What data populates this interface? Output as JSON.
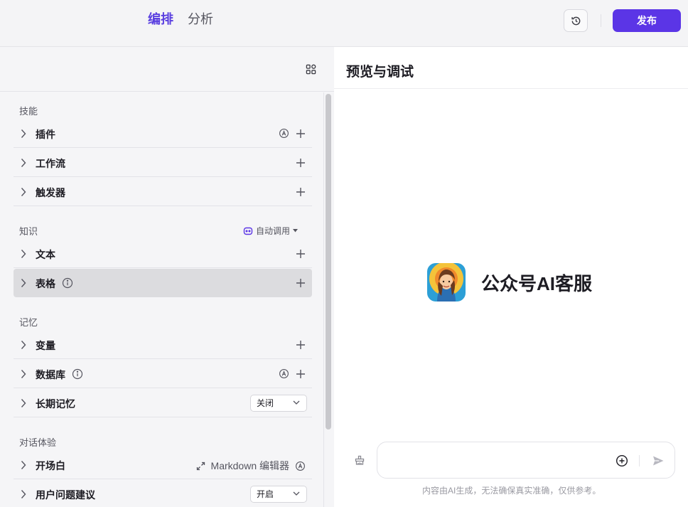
{
  "header": {
    "tabs": [
      {
        "label": "编排",
        "active": true
      },
      {
        "label": "分析",
        "active": false
      }
    ],
    "publish_label": "发布"
  },
  "left": {
    "sections": {
      "skills": {
        "title": "技能",
        "rows": [
          "插件",
          "工作流",
          "触发器"
        ]
      },
      "knowledge": {
        "title": "知识",
        "auto_call": "自动调用",
        "rows": [
          "文本",
          "表格"
        ]
      },
      "memory": {
        "title": "记忆",
        "rows": [
          "变量",
          "数据库",
          "长期记忆"
        ],
        "long_memory_value": "关闭"
      },
      "dialog": {
        "title": "对话体验",
        "rows": [
          "开场白",
          "用户问题建议"
        ],
        "md_editor": "Markdown 编辑器",
        "suggest_value": "开启"
      }
    }
  },
  "right": {
    "title": "预览与调试",
    "bot_name": "公众号AI客服",
    "input_placeholder": "",
    "disclaimer": "内容由AI生成，无法确保真实准确，仅供参考。"
  },
  "colors": {
    "accent": "#5b35e6",
    "highlight": "#dcdcdf"
  }
}
